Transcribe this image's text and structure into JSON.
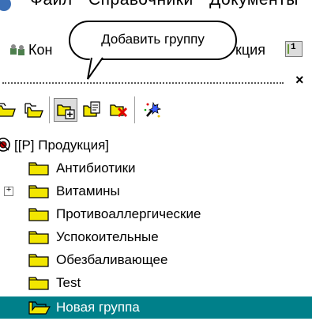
{
  "menu": {
    "items": [
      "Файл",
      "Справочники",
      "Документы"
    ]
  },
  "toolbar": {
    "counterparties_label": "Кон",
    "products_label": "кция",
    "calendar_label": "1"
  },
  "tooltip": {
    "text": "Добавить группу"
  },
  "panel": {
    "close_label": "×"
  },
  "tree": {
    "root_label": "[[P] Продукция]",
    "items": [
      {
        "label": "Антибиотики",
        "expander": ""
      },
      {
        "label": "Витамины",
        "expander": "+"
      },
      {
        "label": "Противоаллергические",
        "expander": ""
      },
      {
        "label": "Успокоительные",
        "expander": ""
      },
      {
        "label": "Обезбаливающее",
        "expander": ""
      },
      {
        "label": "Test",
        "expander": ""
      },
      {
        "label": "Новая группа",
        "expander": ""
      }
    ]
  },
  "colors": {
    "selection": "#00808a",
    "folder": "#f2e600"
  }
}
